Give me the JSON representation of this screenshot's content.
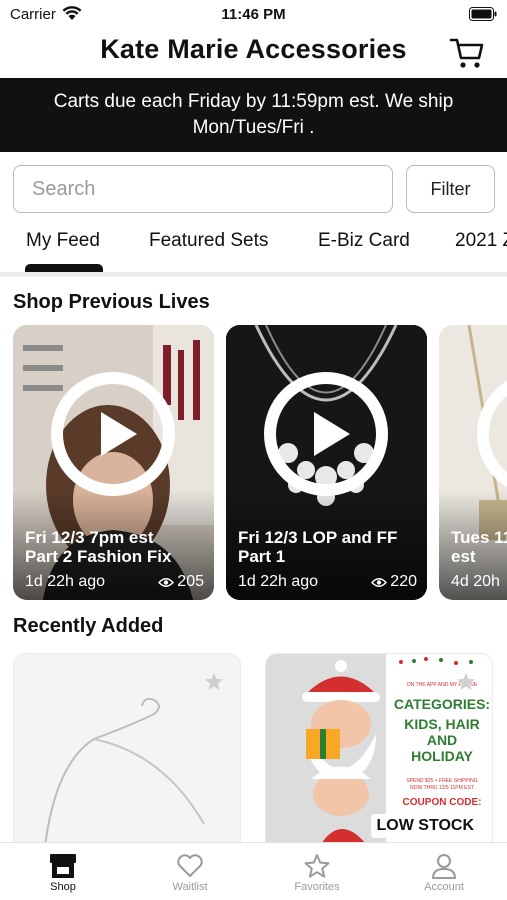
{
  "status_bar": {
    "carrier": "Carrier",
    "time": "11:46 PM"
  },
  "header": {
    "title": "Kate Marie Accessories"
  },
  "banner": {
    "text": "Carts due each Friday by 11:59pm est. We ship Mon/Tues/Fri ."
  },
  "search": {
    "placeholder": "Search",
    "value": "",
    "filter_label": "Filter"
  },
  "tabs": [
    {
      "label": "My Feed",
      "active": true
    },
    {
      "label": "Featured Sets"
    },
    {
      "label": "E-Biz Card"
    },
    {
      "label": "2021 Z"
    }
  ],
  "previous_lives": {
    "title": "Shop Previous Lives",
    "items": [
      {
        "title_line1": "Fri 12/3 7pm est",
        "title_line2": "Part 2 Fashion Fix",
        "age": "1d 22h ago",
        "views": "205"
      },
      {
        "title_line1": "Fri 12/3 LOP and FF",
        "title_line2": "Part 1",
        "age": "1d 22h ago",
        "views": "220"
      },
      {
        "title_line1": "Tues 11",
        "title_line2": "est",
        "age": "4d 20h",
        "views": ""
      }
    ]
  },
  "recently_added": {
    "title": "Recently Added",
    "items": [
      {
        "badge": ""
      },
      {
        "badge": "LOW STOCK",
        "promo_top": "ON THE APP AND MY FB LIVE",
        "promo_heading": "CATEGORIES:",
        "promo_lines": [
          "KIDS, HAIR",
          "AND",
          "HOLIDAY"
        ],
        "promo_small": [
          "SPEND $25 + FREE SHIPPING",
          "NOW THRU 12/5 11PM EST"
        ],
        "promo_code": "COUPON CODE:"
      }
    ]
  },
  "tab_bar": [
    {
      "label": "Shop",
      "icon": "storefront-icon",
      "active": true
    },
    {
      "label": "Waitlist",
      "icon": "heart-icon"
    },
    {
      "label": "Favorites",
      "icon": "star-icon"
    },
    {
      "label": "Account",
      "icon": "person-icon"
    }
  ],
  "colors": {
    "banner_bg": "#111111",
    "accent": "#111111",
    "inactive": "#9a9a9a"
  }
}
